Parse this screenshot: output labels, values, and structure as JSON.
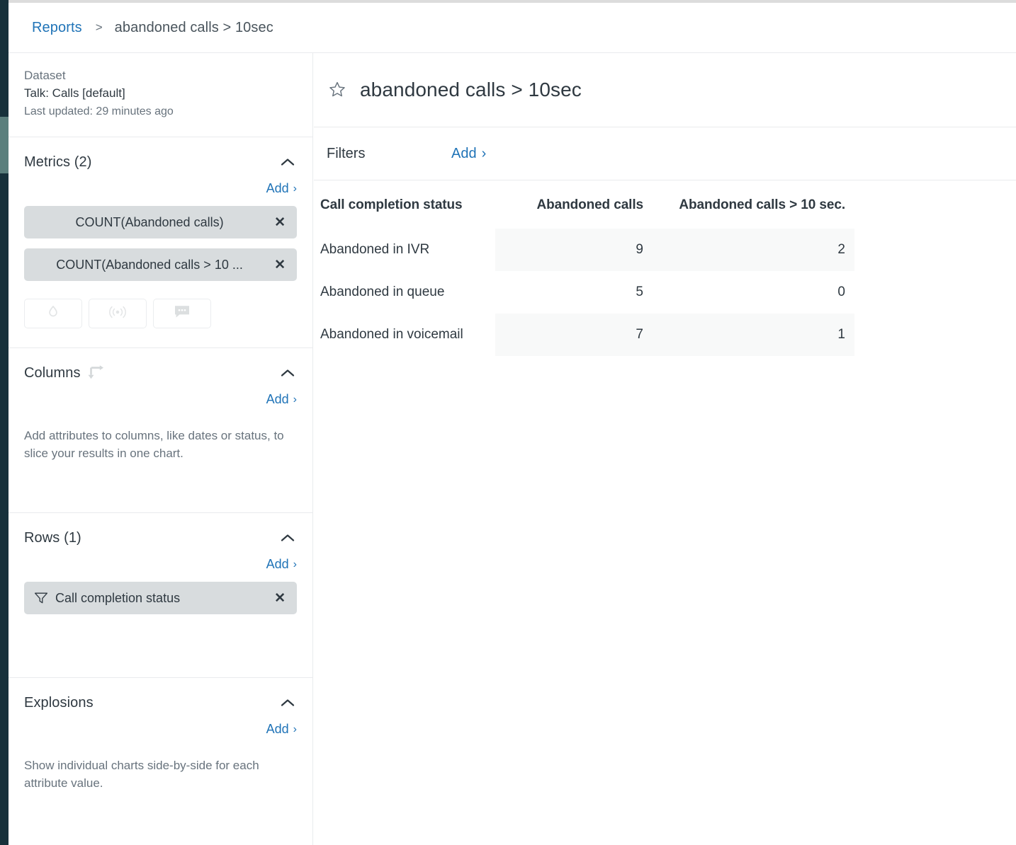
{
  "breadcrumb": {
    "root_label": "Reports",
    "separator": ">",
    "current_label": "abandoned calls > 10sec"
  },
  "sidebar": {
    "dataset": {
      "label": "Dataset",
      "name": "Talk: Calls [default]",
      "last_updated": "Last updated: 29 minutes ago"
    },
    "metrics": {
      "title": "Metrics (2)",
      "add_label": "Add",
      "add_chevron": "›",
      "collapse_icon": "chevron-up-icon",
      "chips": [
        {
          "label": "COUNT(Abandoned calls)",
          "remove": "✕"
        },
        {
          "label": "COUNT(Abandoned calls > 10 ...",
          "remove": "✕"
        }
      ],
      "icon_buttons": [
        {
          "name": "droplet-icon"
        },
        {
          "name": "broadcast-icon"
        },
        {
          "name": "chat-bubble-icon"
        }
      ]
    },
    "columns": {
      "title": "Columns",
      "swap_icon": "swap-rows-columns-icon",
      "add_label": "Add",
      "add_chevron": "›",
      "description": "Add attributes to columns, like dates or status, to slice your results in one chart."
    },
    "rows": {
      "title": "Rows (1)",
      "add_label": "Add",
      "add_chevron": "›",
      "chips": [
        {
          "label": "Call completion status",
          "remove": "✕",
          "icon": "funnel-icon"
        }
      ]
    },
    "explosions": {
      "title": "Explosions",
      "add_label": "Add",
      "add_chevron": "›",
      "description": "Show individual charts side-by-side for each attribute value."
    }
  },
  "main": {
    "report_title": "abandoned calls > 10sec",
    "star_icon": "star-outline-icon",
    "filters": {
      "label": "Filters",
      "add_label": "Add",
      "add_chevron": "›"
    }
  },
  "chart_data": {
    "type": "table",
    "title": "abandoned calls > 10sec",
    "columns": [
      "Call completion status",
      "Abandoned calls",
      "Abandoned calls > 10 sec."
    ],
    "rows": [
      {
        "label": "Abandoned in IVR",
        "values": [
          9,
          2
        ]
      },
      {
        "label": "Abandoned in queue",
        "values": [
          5,
          0
        ]
      },
      {
        "label": "Abandoned in voicemail",
        "values": [
          7,
          1
        ]
      }
    ],
    "categories": [
      "Abandoned in IVR",
      "Abandoned in queue",
      "Abandoned in voicemail"
    ],
    "series": [
      {
        "name": "Abandoned calls",
        "values": [
          9,
          5,
          7
        ]
      },
      {
        "name": "Abandoned calls > 10 sec.",
        "values": [
          2,
          0,
          1
        ]
      }
    ],
    "xlabel": "Call completion status",
    "ylabel": "",
    "legend": "none",
    "grid": false
  },
  "colors": {
    "accent_link": "#1f73b7",
    "rail_dark": "#17313b",
    "rail_marker": "#5b7f7d",
    "chip_bg": "#d8dcde",
    "stripe": "#f8f9f9",
    "text_primary": "#2f3941",
    "text_secondary": "#68737d"
  }
}
